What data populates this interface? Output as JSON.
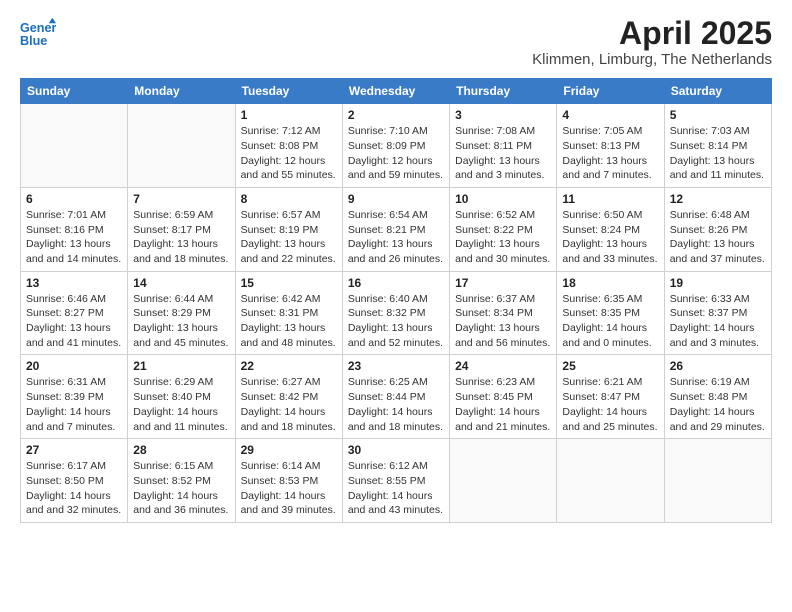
{
  "logo": {
    "text_general": "General",
    "text_blue": "Blue"
  },
  "title": "April 2025",
  "subtitle": "Klimmen, Limburg, The Netherlands",
  "weekdays": [
    "Sunday",
    "Monday",
    "Tuesday",
    "Wednesday",
    "Thursday",
    "Friday",
    "Saturday"
  ],
  "weeks": [
    [
      {
        "day": "",
        "sunrise": "",
        "sunset": "",
        "daylight": ""
      },
      {
        "day": "",
        "sunrise": "",
        "sunset": "",
        "daylight": ""
      },
      {
        "day": "1",
        "sunrise": "Sunrise: 7:12 AM",
        "sunset": "Sunset: 8:08 PM",
        "daylight": "Daylight: 12 hours and 55 minutes."
      },
      {
        "day": "2",
        "sunrise": "Sunrise: 7:10 AM",
        "sunset": "Sunset: 8:09 PM",
        "daylight": "Daylight: 12 hours and 59 minutes."
      },
      {
        "day": "3",
        "sunrise": "Sunrise: 7:08 AM",
        "sunset": "Sunset: 8:11 PM",
        "daylight": "Daylight: 13 hours and 3 minutes."
      },
      {
        "day": "4",
        "sunrise": "Sunrise: 7:05 AM",
        "sunset": "Sunset: 8:13 PM",
        "daylight": "Daylight: 13 hours and 7 minutes."
      },
      {
        "day": "5",
        "sunrise": "Sunrise: 7:03 AM",
        "sunset": "Sunset: 8:14 PM",
        "daylight": "Daylight: 13 hours and 11 minutes."
      }
    ],
    [
      {
        "day": "6",
        "sunrise": "Sunrise: 7:01 AM",
        "sunset": "Sunset: 8:16 PM",
        "daylight": "Daylight: 13 hours and 14 minutes."
      },
      {
        "day": "7",
        "sunrise": "Sunrise: 6:59 AM",
        "sunset": "Sunset: 8:17 PM",
        "daylight": "Daylight: 13 hours and 18 minutes."
      },
      {
        "day": "8",
        "sunrise": "Sunrise: 6:57 AM",
        "sunset": "Sunset: 8:19 PM",
        "daylight": "Daylight: 13 hours and 22 minutes."
      },
      {
        "day": "9",
        "sunrise": "Sunrise: 6:54 AM",
        "sunset": "Sunset: 8:21 PM",
        "daylight": "Daylight: 13 hours and 26 minutes."
      },
      {
        "day": "10",
        "sunrise": "Sunrise: 6:52 AM",
        "sunset": "Sunset: 8:22 PM",
        "daylight": "Daylight: 13 hours and 30 minutes."
      },
      {
        "day": "11",
        "sunrise": "Sunrise: 6:50 AM",
        "sunset": "Sunset: 8:24 PM",
        "daylight": "Daylight: 13 hours and 33 minutes."
      },
      {
        "day": "12",
        "sunrise": "Sunrise: 6:48 AM",
        "sunset": "Sunset: 8:26 PM",
        "daylight": "Daylight: 13 hours and 37 minutes."
      }
    ],
    [
      {
        "day": "13",
        "sunrise": "Sunrise: 6:46 AM",
        "sunset": "Sunset: 8:27 PM",
        "daylight": "Daylight: 13 hours and 41 minutes."
      },
      {
        "day": "14",
        "sunrise": "Sunrise: 6:44 AM",
        "sunset": "Sunset: 8:29 PM",
        "daylight": "Daylight: 13 hours and 45 minutes."
      },
      {
        "day": "15",
        "sunrise": "Sunrise: 6:42 AM",
        "sunset": "Sunset: 8:31 PM",
        "daylight": "Daylight: 13 hours and 48 minutes."
      },
      {
        "day": "16",
        "sunrise": "Sunrise: 6:40 AM",
        "sunset": "Sunset: 8:32 PM",
        "daylight": "Daylight: 13 hours and 52 minutes."
      },
      {
        "day": "17",
        "sunrise": "Sunrise: 6:37 AM",
        "sunset": "Sunset: 8:34 PM",
        "daylight": "Daylight: 13 hours and 56 minutes."
      },
      {
        "day": "18",
        "sunrise": "Sunrise: 6:35 AM",
        "sunset": "Sunset: 8:35 PM",
        "daylight": "Daylight: 14 hours and 0 minutes."
      },
      {
        "day": "19",
        "sunrise": "Sunrise: 6:33 AM",
        "sunset": "Sunset: 8:37 PM",
        "daylight": "Daylight: 14 hours and 3 minutes."
      }
    ],
    [
      {
        "day": "20",
        "sunrise": "Sunrise: 6:31 AM",
        "sunset": "Sunset: 8:39 PM",
        "daylight": "Daylight: 14 hours and 7 minutes."
      },
      {
        "day": "21",
        "sunrise": "Sunrise: 6:29 AM",
        "sunset": "Sunset: 8:40 PM",
        "daylight": "Daylight: 14 hours and 11 minutes."
      },
      {
        "day": "22",
        "sunrise": "Sunrise: 6:27 AM",
        "sunset": "Sunset: 8:42 PM",
        "daylight": "Daylight: 14 hours and 18 minutes."
      },
      {
        "day": "23",
        "sunrise": "Sunrise: 6:25 AM",
        "sunset": "Sunset: 8:44 PM",
        "daylight": "Daylight: 14 hours and 18 minutes."
      },
      {
        "day": "24",
        "sunrise": "Sunrise: 6:23 AM",
        "sunset": "Sunset: 8:45 PM",
        "daylight": "Daylight: 14 hours and 21 minutes."
      },
      {
        "day": "25",
        "sunrise": "Sunrise: 6:21 AM",
        "sunset": "Sunset: 8:47 PM",
        "daylight": "Daylight: 14 hours and 25 minutes."
      },
      {
        "day": "26",
        "sunrise": "Sunrise: 6:19 AM",
        "sunset": "Sunset: 8:48 PM",
        "daylight": "Daylight: 14 hours and 29 minutes."
      }
    ],
    [
      {
        "day": "27",
        "sunrise": "Sunrise: 6:17 AM",
        "sunset": "Sunset: 8:50 PM",
        "daylight": "Daylight: 14 hours and 32 minutes."
      },
      {
        "day": "28",
        "sunrise": "Sunrise: 6:15 AM",
        "sunset": "Sunset: 8:52 PM",
        "daylight": "Daylight: 14 hours and 36 minutes."
      },
      {
        "day": "29",
        "sunrise": "Sunrise: 6:14 AM",
        "sunset": "Sunset: 8:53 PM",
        "daylight": "Daylight: 14 hours and 39 minutes."
      },
      {
        "day": "30",
        "sunrise": "Sunrise: 6:12 AM",
        "sunset": "Sunset: 8:55 PM",
        "daylight": "Daylight: 14 hours and 43 minutes."
      },
      {
        "day": "",
        "sunrise": "",
        "sunset": "",
        "daylight": ""
      },
      {
        "day": "",
        "sunrise": "",
        "sunset": "",
        "daylight": ""
      },
      {
        "day": "",
        "sunrise": "",
        "sunset": "",
        "daylight": ""
      }
    ]
  ]
}
